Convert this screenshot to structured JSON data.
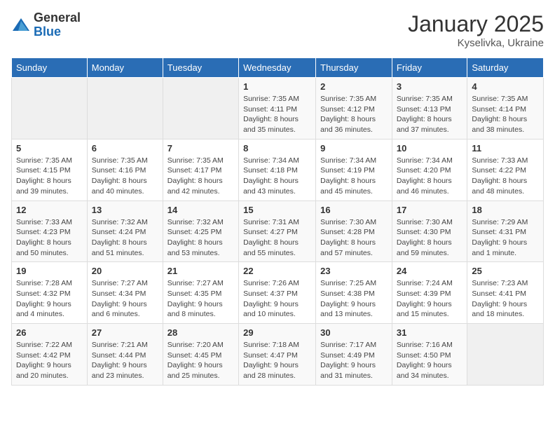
{
  "logo": {
    "general": "General",
    "blue": "Blue"
  },
  "title": {
    "month_year": "January 2025",
    "location": "Kyselivka, Ukraine"
  },
  "weekdays": [
    "Sunday",
    "Monday",
    "Tuesday",
    "Wednesday",
    "Thursday",
    "Friday",
    "Saturday"
  ],
  "weeks": [
    [
      {
        "day": "",
        "info": ""
      },
      {
        "day": "",
        "info": ""
      },
      {
        "day": "",
        "info": ""
      },
      {
        "day": "1",
        "info": "Sunrise: 7:35 AM\nSunset: 4:11 PM\nDaylight: 8 hours and 35 minutes."
      },
      {
        "day": "2",
        "info": "Sunrise: 7:35 AM\nSunset: 4:12 PM\nDaylight: 8 hours and 36 minutes."
      },
      {
        "day": "3",
        "info": "Sunrise: 7:35 AM\nSunset: 4:13 PM\nDaylight: 8 hours and 37 minutes."
      },
      {
        "day": "4",
        "info": "Sunrise: 7:35 AM\nSunset: 4:14 PM\nDaylight: 8 hours and 38 minutes."
      }
    ],
    [
      {
        "day": "5",
        "info": "Sunrise: 7:35 AM\nSunset: 4:15 PM\nDaylight: 8 hours and 39 minutes."
      },
      {
        "day": "6",
        "info": "Sunrise: 7:35 AM\nSunset: 4:16 PM\nDaylight: 8 hours and 40 minutes."
      },
      {
        "day": "7",
        "info": "Sunrise: 7:35 AM\nSunset: 4:17 PM\nDaylight: 8 hours and 42 minutes."
      },
      {
        "day": "8",
        "info": "Sunrise: 7:34 AM\nSunset: 4:18 PM\nDaylight: 8 hours and 43 minutes."
      },
      {
        "day": "9",
        "info": "Sunrise: 7:34 AM\nSunset: 4:19 PM\nDaylight: 8 hours and 45 minutes."
      },
      {
        "day": "10",
        "info": "Sunrise: 7:34 AM\nSunset: 4:20 PM\nDaylight: 8 hours and 46 minutes."
      },
      {
        "day": "11",
        "info": "Sunrise: 7:33 AM\nSunset: 4:22 PM\nDaylight: 8 hours and 48 minutes."
      }
    ],
    [
      {
        "day": "12",
        "info": "Sunrise: 7:33 AM\nSunset: 4:23 PM\nDaylight: 8 hours and 50 minutes."
      },
      {
        "day": "13",
        "info": "Sunrise: 7:32 AM\nSunset: 4:24 PM\nDaylight: 8 hours and 51 minutes."
      },
      {
        "day": "14",
        "info": "Sunrise: 7:32 AM\nSunset: 4:25 PM\nDaylight: 8 hours and 53 minutes."
      },
      {
        "day": "15",
        "info": "Sunrise: 7:31 AM\nSunset: 4:27 PM\nDaylight: 8 hours and 55 minutes."
      },
      {
        "day": "16",
        "info": "Sunrise: 7:30 AM\nSunset: 4:28 PM\nDaylight: 8 hours and 57 minutes."
      },
      {
        "day": "17",
        "info": "Sunrise: 7:30 AM\nSunset: 4:30 PM\nDaylight: 8 hours and 59 minutes."
      },
      {
        "day": "18",
        "info": "Sunrise: 7:29 AM\nSunset: 4:31 PM\nDaylight: 9 hours and 1 minute."
      }
    ],
    [
      {
        "day": "19",
        "info": "Sunrise: 7:28 AM\nSunset: 4:32 PM\nDaylight: 9 hours and 4 minutes."
      },
      {
        "day": "20",
        "info": "Sunrise: 7:27 AM\nSunset: 4:34 PM\nDaylight: 9 hours and 6 minutes."
      },
      {
        "day": "21",
        "info": "Sunrise: 7:27 AM\nSunset: 4:35 PM\nDaylight: 9 hours and 8 minutes."
      },
      {
        "day": "22",
        "info": "Sunrise: 7:26 AM\nSunset: 4:37 PM\nDaylight: 9 hours and 10 minutes."
      },
      {
        "day": "23",
        "info": "Sunrise: 7:25 AM\nSunset: 4:38 PM\nDaylight: 9 hours and 13 minutes."
      },
      {
        "day": "24",
        "info": "Sunrise: 7:24 AM\nSunset: 4:39 PM\nDaylight: 9 hours and 15 minutes."
      },
      {
        "day": "25",
        "info": "Sunrise: 7:23 AM\nSunset: 4:41 PM\nDaylight: 9 hours and 18 minutes."
      }
    ],
    [
      {
        "day": "26",
        "info": "Sunrise: 7:22 AM\nSunset: 4:42 PM\nDaylight: 9 hours and 20 minutes."
      },
      {
        "day": "27",
        "info": "Sunrise: 7:21 AM\nSunset: 4:44 PM\nDaylight: 9 hours and 23 minutes."
      },
      {
        "day": "28",
        "info": "Sunrise: 7:20 AM\nSunset: 4:45 PM\nDaylight: 9 hours and 25 minutes."
      },
      {
        "day": "29",
        "info": "Sunrise: 7:18 AM\nSunset: 4:47 PM\nDaylight: 9 hours and 28 minutes."
      },
      {
        "day": "30",
        "info": "Sunrise: 7:17 AM\nSunset: 4:49 PM\nDaylight: 9 hours and 31 minutes."
      },
      {
        "day": "31",
        "info": "Sunrise: 7:16 AM\nSunset: 4:50 PM\nDaylight: 9 hours and 34 minutes."
      },
      {
        "day": "",
        "info": ""
      }
    ]
  ]
}
